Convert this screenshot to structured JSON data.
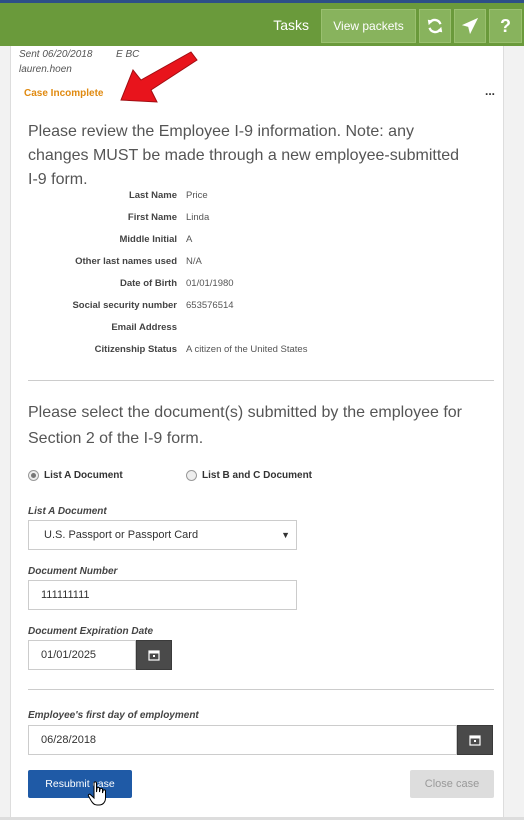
{
  "header": {
    "title": "Tasks",
    "view_packets": "View packets",
    "refresh_icon": "refresh-icon",
    "send_icon": "send-icon",
    "help_label": "?"
  },
  "case": {
    "sent": "Sent 06/20/2018",
    "sent_extra": "E          BC",
    "user": "lauren.hoen",
    "status": "Case Incomplete",
    "menu_dots": "..."
  },
  "review": {
    "prompt": "Please review the Employee I-9 information. Note: any changes MUST be made through a new employee-submitted I-9 form.",
    "fields": [
      {
        "label": "Last Name",
        "value": "Price"
      },
      {
        "label": "First Name",
        "value": "Linda"
      },
      {
        "label": "Middle Initial",
        "value": "A"
      },
      {
        "label": "Other last names used",
        "value": "N/A"
      },
      {
        "label": "Date of Birth",
        "value": "01/01/1980"
      },
      {
        "label": "Social security number",
        "value": "653576514"
      },
      {
        "label": "Email Address",
        "value": ""
      },
      {
        "label": "Citizenship Status",
        "value": "A citizen of the United States"
      }
    ]
  },
  "section2": {
    "prompt": "Please select the document(s) submitted by the employee for Section 2 of the I-9 form.",
    "radio_a": "List A Document",
    "radio_bc": "List B and C Document",
    "list_a_label": "List A Document",
    "list_a_value": "U.S. Passport or Passport Card",
    "doc_number_label": "Document Number",
    "doc_number_value": "111111111",
    "exp_label": "Document Expiration Date",
    "exp_value": "01/01/2025",
    "first_day_label": "Employee's first day of employment",
    "first_day_value": "06/28/2018"
  },
  "actions": {
    "resubmit": "Resubmit case",
    "close": "Close case"
  },
  "colors": {
    "topbar": "#6a9a3b",
    "status": "#e08a10",
    "primary": "#1f5aa6",
    "annotation_arrow": "#e8141c"
  }
}
